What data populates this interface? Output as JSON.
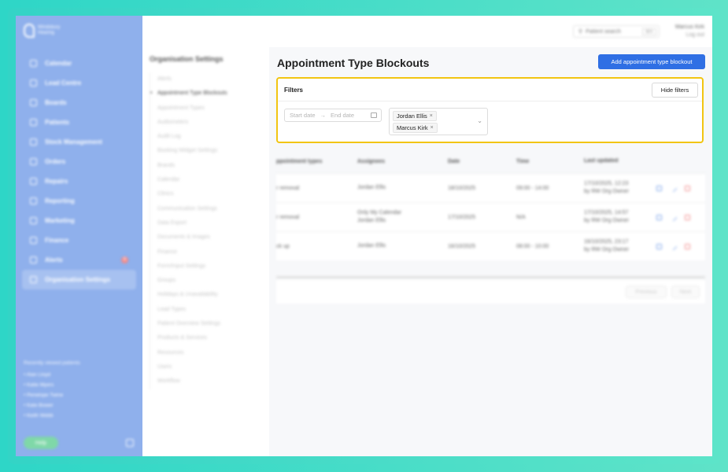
{
  "sidebar": {
    "brand": "Windsbury Hearing",
    "items": [
      {
        "label": "Calendar",
        "icon": "calendar-icon"
      },
      {
        "label": "Lead Centre",
        "icon": "headset-icon"
      },
      {
        "label": "Boards",
        "icon": "board-icon"
      },
      {
        "label": "Patients",
        "icon": "patients-icon"
      },
      {
        "label": "Stock Management",
        "icon": "box-icon"
      },
      {
        "label": "Orders",
        "icon": "orders-icon"
      },
      {
        "label": "Repairs",
        "icon": "wrench-icon"
      },
      {
        "label": "Reporting",
        "icon": "chart-icon"
      },
      {
        "label": "Marketing",
        "icon": "mail-icon"
      },
      {
        "label": "Finance",
        "icon": "finance-icon"
      },
      {
        "label": "Alerts",
        "icon": "bell-icon",
        "badge": "5"
      },
      {
        "label": "Organisation Settings",
        "icon": "gear-icon",
        "active": true
      }
    ],
    "recent_title": "Recently viewed patients",
    "recent": [
      "• Alan Lloyd",
      "• Katie Myers",
      "• Penelope Twine",
      "• Kate Bower",
      "• Keith Webb"
    ],
    "help_label": "Help"
  },
  "settings_nav": {
    "title": "Organisation Settings",
    "items": [
      "Alerts",
      "Appointment Type Blockouts",
      "Appointment Types",
      "Audiometers",
      "Audit Log",
      "Booking Widget Settings",
      "Brands",
      "Calendar",
      "Clinics",
      "Communication Settings",
      "Data Export",
      "Documents & Images",
      "Finance",
      "Form/Input Settings",
      "Groups",
      "Holidays & Unavailability",
      "Lead Types",
      "Patient Overview Settings",
      "Products & Services",
      "Resources",
      "Users",
      "Workflow"
    ],
    "current_index": 1
  },
  "topbar": {
    "search_placeholder": "Patient search",
    "search_shortcut": "⌘K",
    "user_name": "Marcus Kirk",
    "logout": "Log out"
  },
  "main": {
    "title": "Appointment Type Blockouts",
    "add_button": "Add appointment type blockout",
    "filters": {
      "label": "Filters",
      "hide_button": "Hide filters",
      "start_placeholder": "Start date",
      "end_placeholder": "End date",
      "assignees": [
        "Jordan Ellis",
        "Marcus Kirk"
      ]
    },
    "table": {
      "headers": [
        "ppointment types",
        "Assignees",
        "Date",
        "Time",
        "Last updated"
      ],
      "rows": [
        {
          "type": "r removal",
          "assignees": "Jordan Ellis",
          "date": "18/10/2025",
          "time": "09:00 - 14:00",
          "updated1": "17/10/2025, 12:23",
          "updated2": "by RW Org Owner"
        },
        {
          "type": "r removal",
          "assignees": "Only My Calendar\nJordan Ellis",
          "date": "17/10/2025",
          "time": "N/A",
          "updated1": "17/10/2025, 14:57",
          "updated2": "by RW Org Owner"
        },
        {
          "type": "ck up",
          "assignees": "Jordan Ellis",
          "date": "16/10/2025",
          "time": "08:00 - 10:00",
          "updated1": "16/10/2025, 23:17",
          "updated2": "by RW Org Owner"
        }
      ]
    },
    "pager": {
      "previous": "Previous",
      "next": "Next"
    }
  },
  "colors": {
    "accent": "#2f6fe4",
    "sidebar": "#8fb0ec",
    "highlight": "#f2c511",
    "frame": "#33d4c6"
  }
}
